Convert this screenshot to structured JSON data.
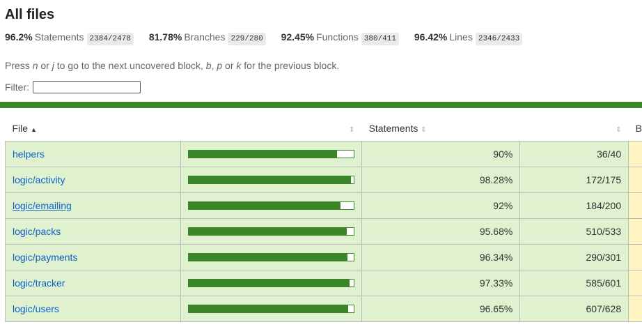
{
  "title": "All files",
  "summary": [
    {
      "pct": "96.2%",
      "label": "Statements",
      "frac": "2384/2478"
    },
    {
      "pct": "81.78%",
      "label": "Branches",
      "frac": "229/280"
    },
    {
      "pct": "92.45%",
      "label": "Functions",
      "frac": "380/411"
    },
    {
      "pct": "96.42%",
      "label": "Lines",
      "frac": "2346/2433"
    }
  ],
  "hint": {
    "prefix": "Press ",
    "k1": "n",
    "mid1": " or ",
    "k2": "j",
    "mid2": " to go to the next uncovered block, ",
    "k3": "b",
    "mid3": ", ",
    "k4": "p",
    "mid4": " or ",
    "k5": "k",
    "suffix": " for the previous block."
  },
  "filter": {
    "label": "Filter:",
    "value": ""
  },
  "table": {
    "headers": {
      "file": "File",
      "sort_up": "▲",
      "sorter": "⇕",
      "statements": "Statements",
      "next": "B"
    },
    "rows": [
      {
        "file": "helpers",
        "pct": "90%",
        "frac": "36/40",
        "fill": 0.9,
        "underline": false
      },
      {
        "file": "logic/activity",
        "pct": "98.28%",
        "frac": "172/175",
        "fill": 0.9828,
        "underline": false
      },
      {
        "file": "logic/emailing",
        "pct": "92%",
        "frac": "184/200",
        "fill": 0.92,
        "underline": true
      },
      {
        "file": "logic/packs",
        "pct": "95.68%",
        "frac": "510/533",
        "fill": 0.9568,
        "underline": false
      },
      {
        "file": "logic/payments",
        "pct": "96.34%",
        "frac": "290/301",
        "fill": 0.9634,
        "underline": false
      },
      {
        "file": "logic/tracker",
        "pct": "97.33%",
        "frac": "585/601",
        "fill": 0.9733,
        "underline": false
      },
      {
        "file": "logic/users",
        "pct": "96.65%",
        "frac": "607/628",
        "fill": 0.9665,
        "underline": false
      }
    ]
  },
  "colors": {
    "bar": "#3a8527",
    "row_bg": "#e0f1cf",
    "link": "#0b60c8",
    "next_col_bg": "#fff4c2"
  }
}
